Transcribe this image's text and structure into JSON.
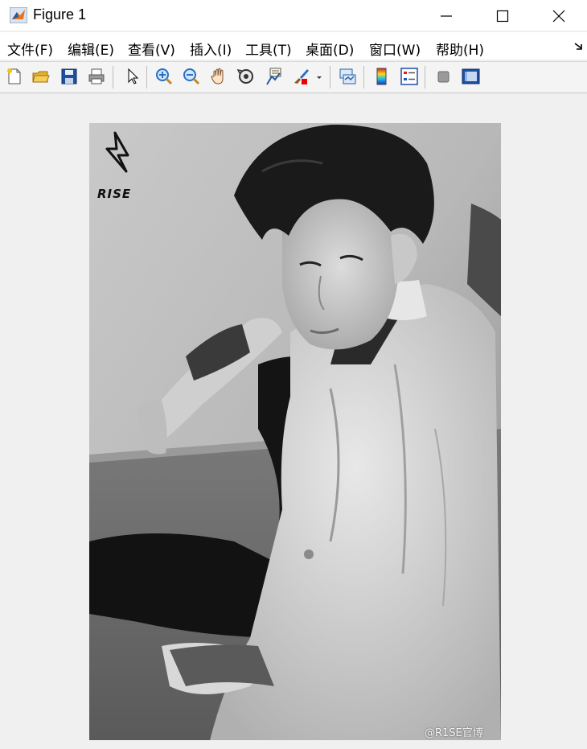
{
  "window": {
    "title": "Figure 1",
    "controls": {
      "minimize": "minimize",
      "maximize": "maximize",
      "close": "close"
    }
  },
  "menu": {
    "items": [
      {
        "label": "文件(F)"
      },
      {
        "label": "编辑(E)"
      },
      {
        "label": "查看(V)"
      },
      {
        "label": "插入(I)"
      },
      {
        "label": "工具(T)"
      },
      {
        "label": "桌面(D)"
      },
      {
        "label": "窗口(W)"
      },
      {
        "label": "帮助(H)"
      }
    ]
  },
  "toolbar": {
    "buttons": [
      "new-figure-icon",
      "open-file-icon",
      "save-icon",
      "print-icon",
      "select-pointer-icon",
      "zoom-in-icon",
      "zoom-out-icon",
      "pan-hand-icon",
      "rotate-3d-icon",
      "data-cursor-icon",
      "brush-icon",
      "link-plot-icon",
      "colorbar-icon",
      "legend-icon",
      "hide-plot-tools-icon",
      "show-plot-tools-icon"
    ]
  },
  "figure": {
    "image_description_logo": "RISE",
    "watermark": "@R1SE官博"
  },
  "colors": {
    "window_bg": "#f0f0f0",
    "titlebar_bg": "#ffffff",
    "matlab_orange": "#e8741a",
    "matlab_blue": "#1f5aa6"
  }
}
